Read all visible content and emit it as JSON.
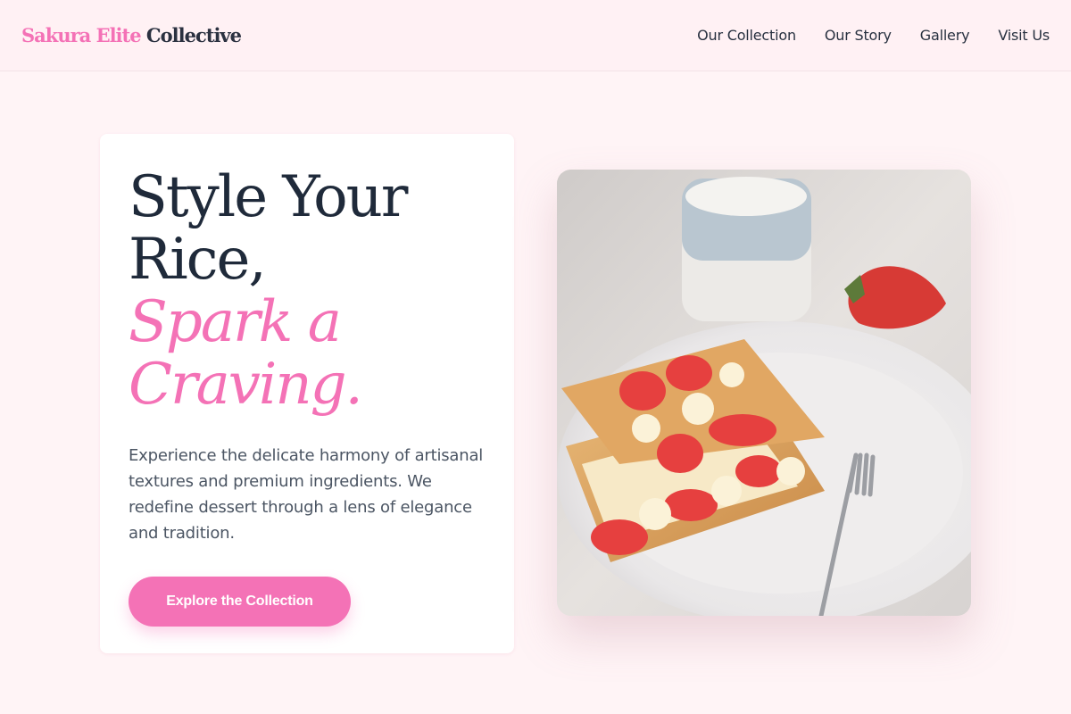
{
  "brand": {
    "name_accent": "Sakura Elite",
    "name_rest": "Collective",
    "accent_color": "#f472b6"
  },
  "nav": {
    "items": [
      {
        "label": "Our Collection"
      },
      {
        "label": "Our Story"
      },
      {
        "label": "Gallery"
      },
      {
        "label": "Visit Us"
      }
    ]
  },
  "hero": {
    "headline_lines": [
      "Style Your",
      "Rice,"
    ],
    "headline_accent_lines": [
      "Spark a",
      "Craving."
    ],
    "description": "Experience the delicate harmony of artisanal textures and premium ingredients. We redefine dessert through a lens of elegance and tradition.",
    "cta_label": "Explore the Collection",
    "image": {
      "subject": "strawberry mille-feuille pastry on a white plate with fork, milk jug and strawberry"
    }
  },
  "colors": {
    "page_background": "#fff4f6",
    "heading": "#1f2a3a",
    "body_text": "#4b5563",
    "button": "#f472b6"
  }
}
